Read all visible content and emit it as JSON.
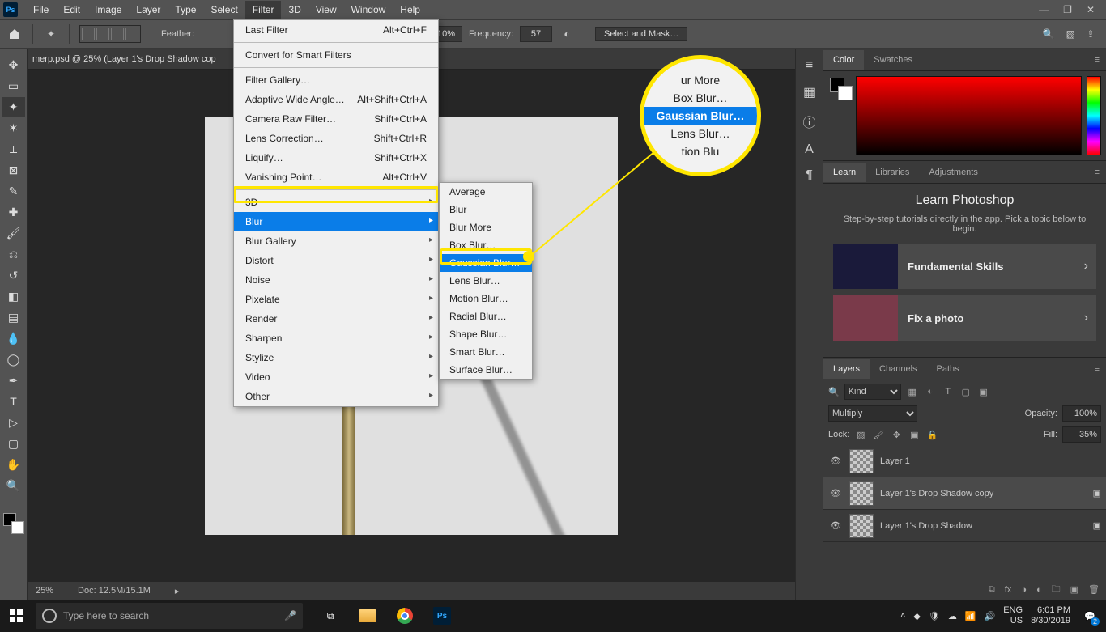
{
  "menubar": {
    "items": [
      "File",
      "Edit",
      "Image",
      "Layer",
      "Type",
      "Select",
      "Filter",
      "3D",
      "View",
      "Window",
      "Help"
    ],
    "active": "Filter"
  },
  "optionsbar": {
    "feather_label": "Feather:",
    "pct": "10%",
    "freq_label": "Frequency:",
    "freq": "57",
    "select_mask": "Select and Mask…"
  },
  "document": {
    "tab": "merp.psd @ 25% (Layer 1's Drop Shadow cop",
    "zoom": "25%",
    "docsize": "Doc: 12.5M/15.1M"
  },
  "filter_menu": {
    "last_filter": {
      "label": "Last Filter",
      "shortcut": "Alt+Ctrl+F"
    },
    "convert": "Convert for Smart Filters",
    "gallery": "Filter Gallery…",
    "wide_angle": {
      "label": "Adaptive Wide Angle…",
      "shortcut": "Alt+Shift+Ctrl+A"
    },
    "camera_raw": {
      "label": "Camera Raw Filter…",
      "shortcut": "Shift+Ctrl+A"
    },
    "lens": {
      "label": "Lens Correction…",
      "shortcut": "Shift+Ctrl+R"
    },
    "liquify": {
      "label": "Liquify…",
      "shortcut": "Shift+Ctrl+X"
    },
    "vanish": {
      "label": "Vanishing Point…",
      "shortcut": "Alt+Ctrl+V"
    },
    "subs": [
      "3D",
      "Blur",
      "Blur Gallery",
      "Distort",
      "Noise",
      "Pixelate",
      "Render",
      "Sharpen",
      "Stylize",
      "Video",
      "Other"
    ],
    "selected": "Blur"
  },
  "blur_submenu": {
    "items": [
      "Average",
      "Blur",
      "Blur More",
      "Box Blur…",
      "Gaussian Blur…",
      "Lens Blur…",
      "Motion Blur…",
      "Radial Blur…",
      "Shape Blur…",
      "Smart Blur…",
      "Surface Blur…"
    ],
    "selected": "Gaussian Blur…"
  },
  "callout": {
    "r1": "ur More",
    "r2": "Box Blur…",
    "r3": "Gaussian Blur…",
    "r4": "Lens Blur…",
    "r5": "tion Blu"
  },
  "right_tabs": {
    "color": "Color",
    "swatches": "Swatches",
    "learn": "Learn",
    "libraries": "Libraries",
    "adjustments": "Adjustments",
    "layers": "Layers",
    "channels": "Channels",
    "paths": "Paths"
  },
  "learn": {
    "title": "Learn Photoshop",
    "desc": "Step-by-step tutorials directly in the app. Pick a topic below to begin.",
    "card1": "Fundamental Skills",
    "card2": "Fix a photo"
  },
  "layers": {
    "kind_label": "Kind",
    "blend": "Multiply",
    "opacity_label": "Opacity:",
    "opacity": "100%",
    "lock_label": "Lock:",
    "fill_label": "Fill:",
    "fill": "35%",
    "rows": [
      {
        "name": "Layer 1"
      },
      {
        "name": "Layer 1's Drop Shadow copy"
      },
      {
        "name": "Layer 1's Drop Shadow"
      }
    ],
    "selected": 1
  },
  "taskbar": {
    "search_placeholder": "Type here to search",
    "lang": "ENG",
    "locale": "US",
    "time": "6:01 PM",
    "date": "8/30/2019",
    "notif": "2"
  }
}
